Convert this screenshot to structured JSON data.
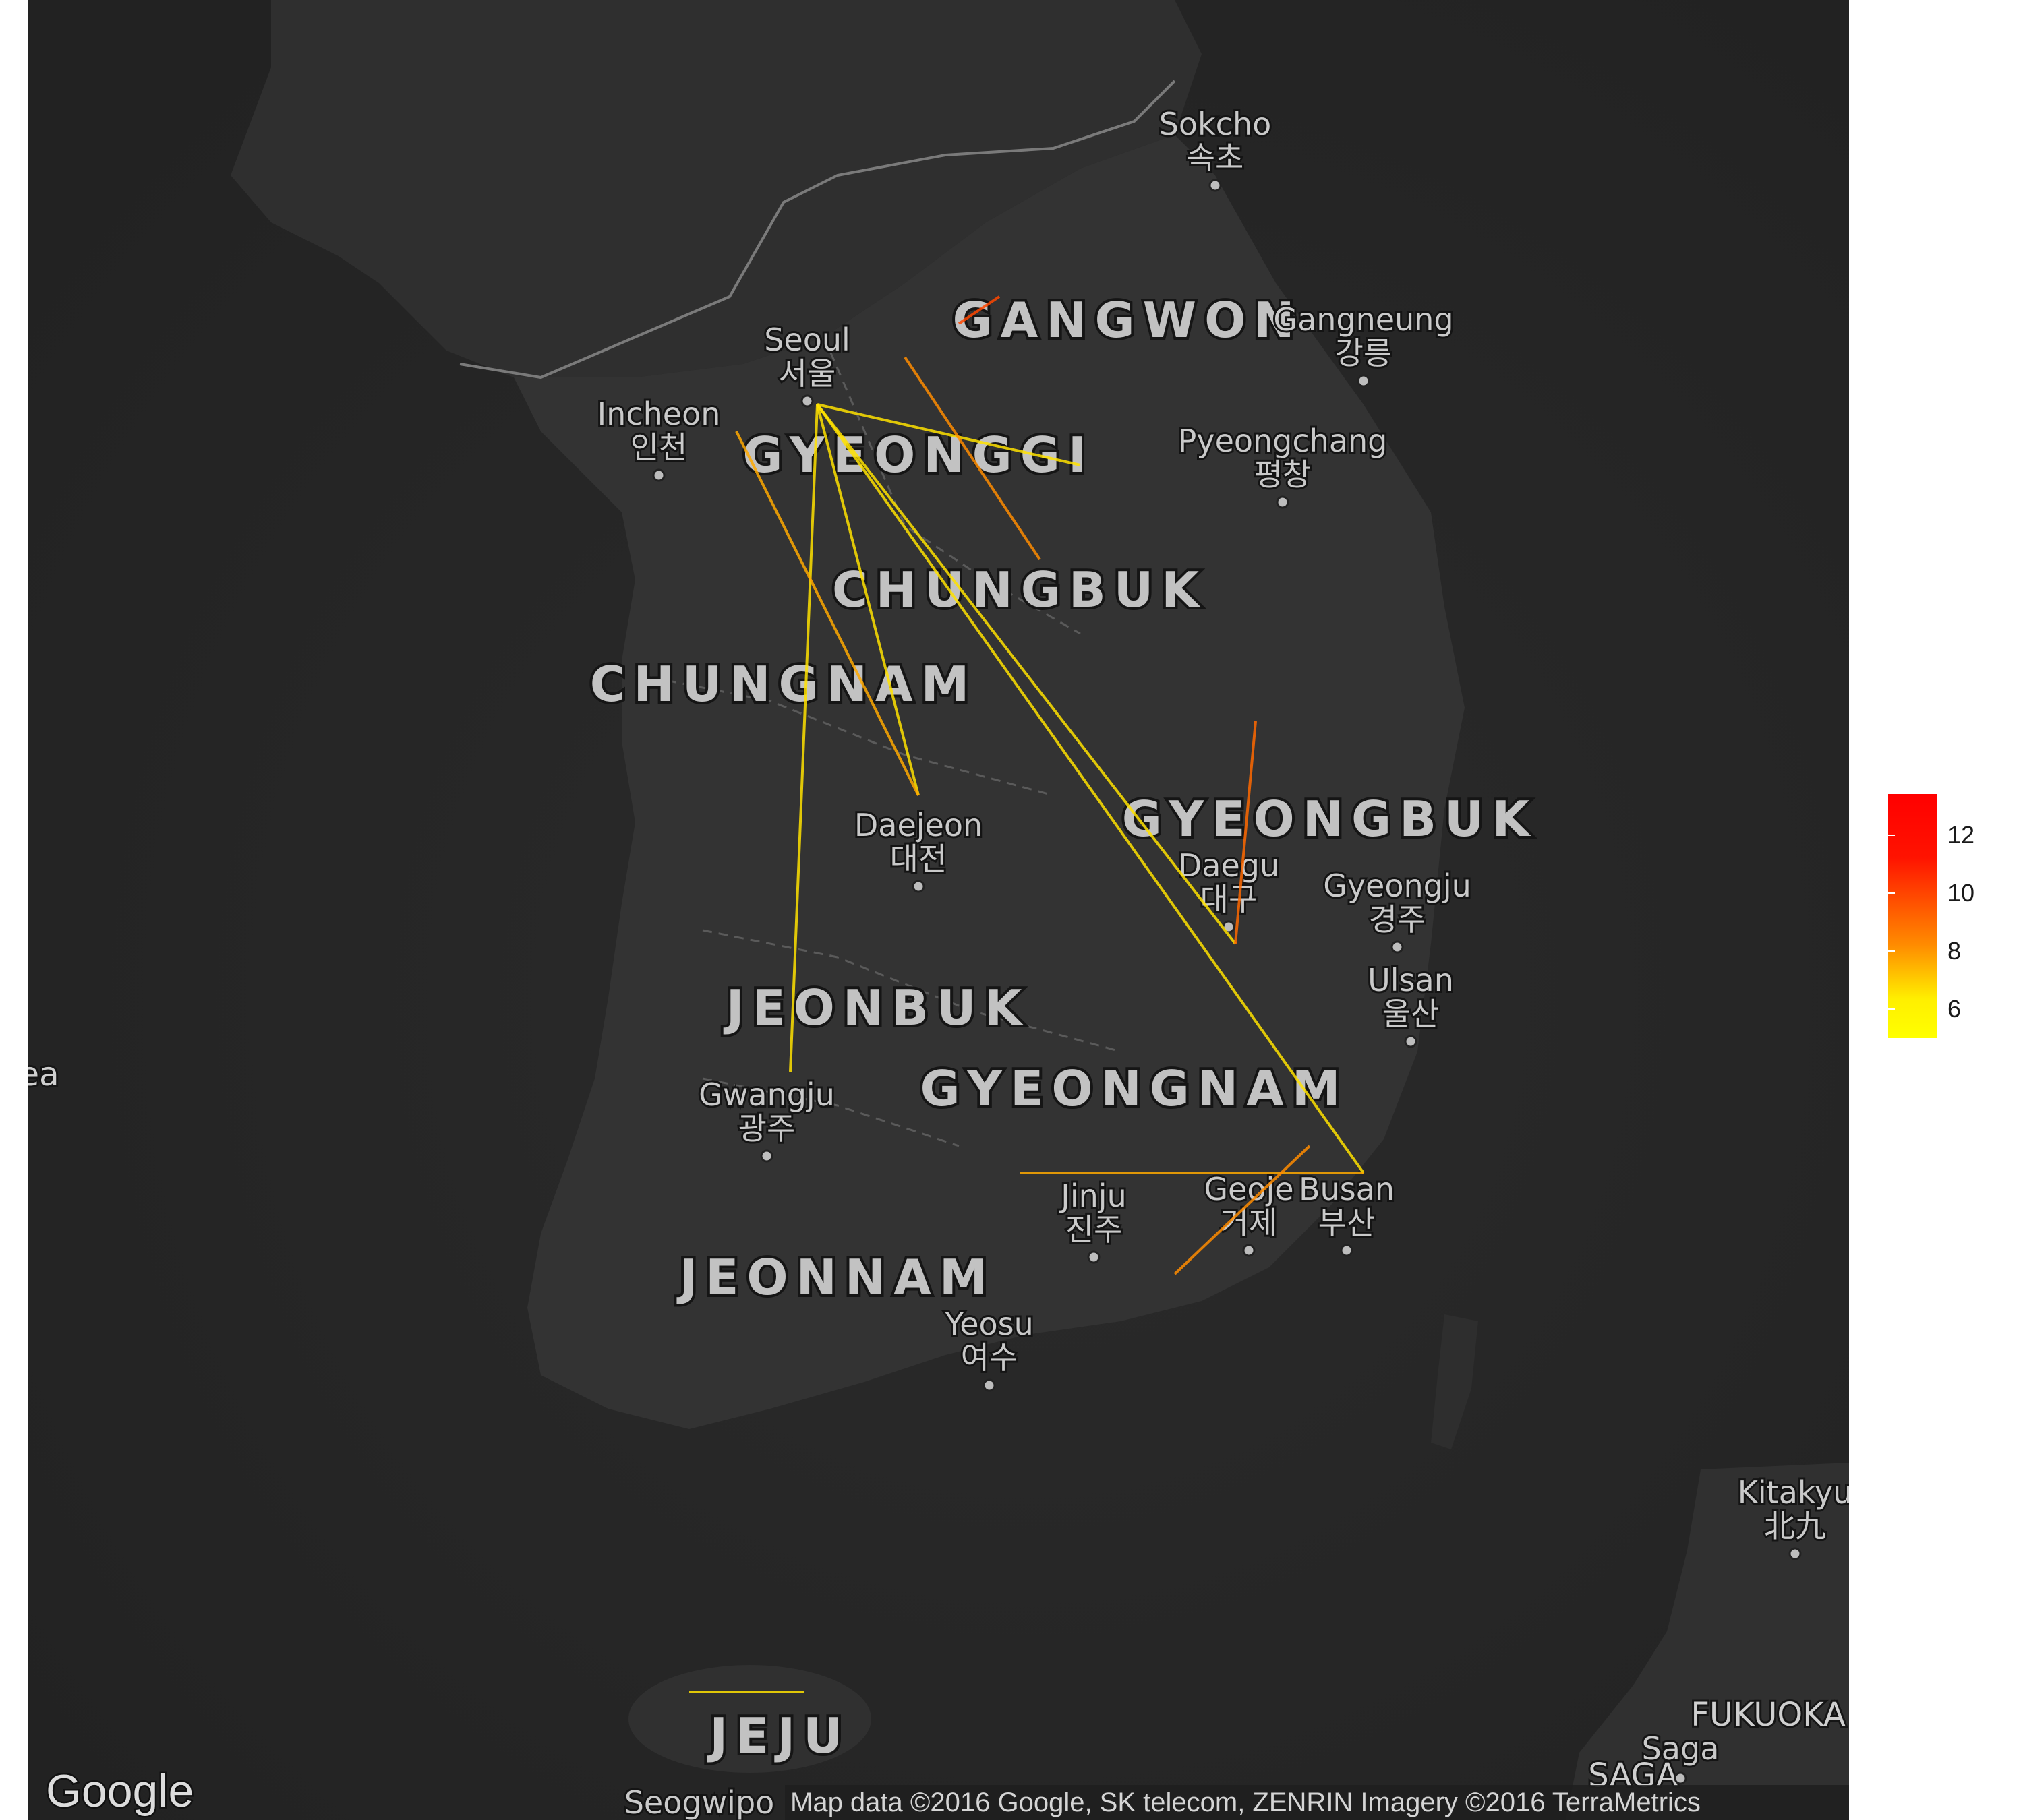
{
  "map": {
    "provider_logo": "Google",
    "attribution": "Map data ©2016 Google, SK telecom, ZENRIN  Imagery ©2016 TerraMetrics",
    "cities": [
      {
        "id": "sokcho",
        "en": "Sokcho",
        "ko": "속초"
      },
      {
        "id": "seoul",
        "en": "Seoul",
        "ko": "서울"
      },
      {
        "id": "gangneung",
        "en": "Gangneung",
        "ko": "강릉"
      },
      {
        "id": "incheon",
        "en": "Incheon",
        "ko": "인천"
      },
      {
        "id": "pyeongchang",
        "en": "Pyeongchang",
        "ko": "평창"
      },
      {
        "id": "daejeon",
        "en": "Daejeon",
        "ko": "대전"
      },
      {
        "id": "daegu",
        "en": "Daegu",
        "ko": "대구"
      },
      {
        "id": "gyeongju",
        "en": "Gyeongju",
        "ko": "경주"
      },
      {
        "id": "ulsan",
        "en": "Ulsan",
        "ko": "울산"
      },
      {
        "id": "gwangju",
        "en": "Gwangju",
        "ko": "광주"
      },
      {
        "id": "jinju",
        "en": "Jinju",
        "ko": "진주"
      },
      {
        "id": "geoje",
        "en": "Geoje",
        "ko": "거제"
      },
      {
        "id": "busan",
        "en": "Busan",
        "ko": "부산"
      },
      {
        "id": "yeosu",
        "en": "Yeosu",
        "ko": "여수"
      },
      {
        "id": "kitakyushu",
        "en": "Kitakyu",
        "ko": "北九"
      },
      {
        "id": "saga",
        "en": "Saga",
        "ko": ""
      },
      {
        "id": "seogwipo",
        "en": "Seogwipo",
        "ko": ""
      }
    ],
    "regions": [
      {
        "id": "gangwon",
        "label": "GANGWON"
      },
      {
        "id": "gyeonggi",
        "label": "GYEONGGI"
      },
      {
        "id": "chungbuk",
        "label": "CHUNGBUK"
      },
      {
        "id": "chungnam",
        "label": "CHUNGNAM"
      },
      {
        "id": "gyeongbuk",
        "label": "GYEONGBUK"
      },
      {
        "id": "jeonbuk",
        "label": "JEONBUK"
      },
      {
        "id": "gyeongnam",
        "label": "GYEONGNAM"
      },
      {
        "id": "jeonnam",
        "label": "JEONNAM"
      },
      {
        "id": "jeju",
        "label": "JEJU"
      },
      {
        "id": "fukuoka",
        "label": "FUKUOKA"
      },
      {
        "id": "saga-pref",
        "label": "SAGA"
      },
      {
        "id": "sea-edge",
        "label": "ea"
      }
    ]
  },
  "legend": {
    "title": "",
    "labels": [
      "12",
      "10",
      "8",
      "6"
    ],
    "colors": {
      "high": "#ff0000",
      "mid": "#ff8c00",
      "low": "#ffff00"
    }
  },
  "chart_data": {
    "type": "line",
    "description_of_encoding": "",
    "color_scale": {
      "min": 5,
      "max": 13,
      "low": "#ffff00",
      "high": "#ff0000"
    },
    "segments": [
      {
        "from": "Seoul",
        "to": "Daejeon",
        "value": 6
      },
      {
        "from": "Seoul",
        "to": "Daegu",
        "value": 6
      },
      {
        "from": "Seoul",
        "to": "Busan",
        "value": 6
      },
      {
        "from": "Seoul",
        "to": "Gwangju",
        "value": 6
      },
      {
        "from": "Seoul",
        "to": "Pyeongchang",
        "value": 6
      },
      {
        "from": "Gyeonggi",
        "to": "Chungbuk",
        "value": 9
      },
      {
        "from": "Incheon",
        "to": "Daejeon",
        "value": 8
      },
      {
        "from": "Gangwon",
        "to": "Gangwon",
        "value": 11
      },
      {
        "from": "Daegu",
        "to": "Gyeongbuk",
        "value": 10
      },
      {
        "from": "Jinju",
        "to": "Busan",
        "value": 8
      },
      {
        "from": "Geoje",
        "to": "Gyeongnam",
        "value": 9
      },
      {
        "from": "Jeju",
        "to": "Jeju",
        "value": 6
      }
    ]
  }
}
